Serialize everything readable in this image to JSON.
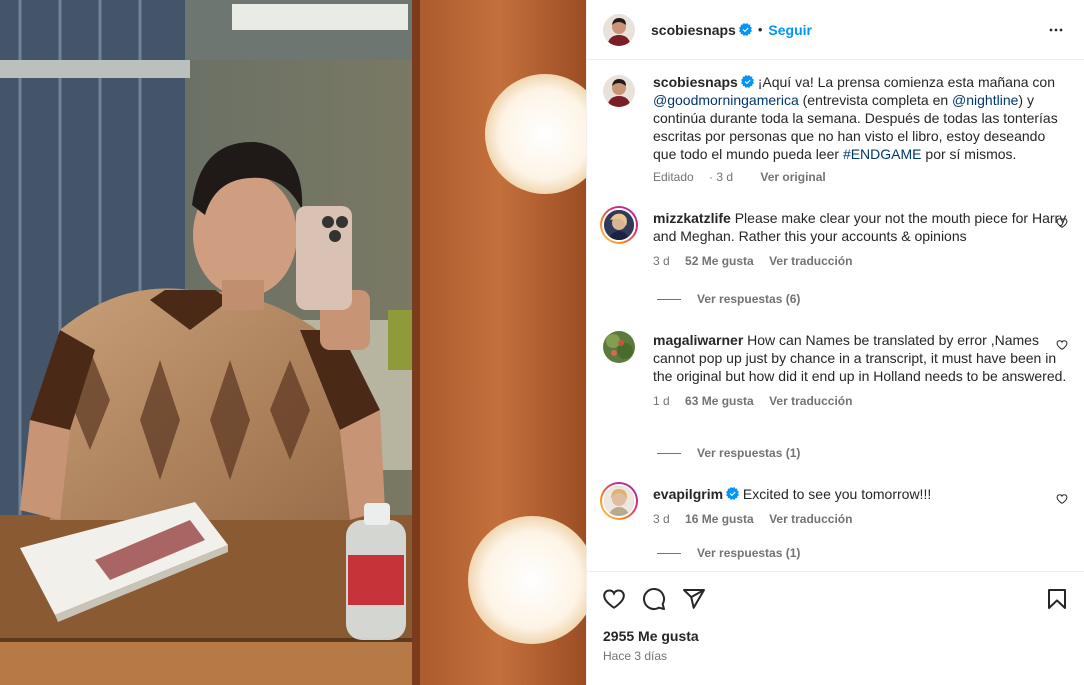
{
  "post": {
    "username": "scobiesnaps",
    "follow_label": "Seguir",
    "separator": "•",
    "caption": {
      "text_before": "¡Aquí va! La prensa comienza esta mañana con ",
      "mention1": "@goodmorningamerica",
      "text_mid": " (entrevista completa en ",
      "mention2": "@nightline",
      "text_after": ") y continúa durante toda la semana. Después de todas las tonterías escritas por personas que no han visto el libro, estoy deseando que todo el mundo pueda leer ",
      "hashtag": "#ENDGAME",
      "text_end": " por sí mismos.",
      "edited_label": "Editado",
      "time": "3 d",
      "see_original": "Ver original"
    },
    "likes_label": "2955 Me gusta",
    "posted_ago": "Hace 3 días"
  },
  "comments": [
    {
      "username": "mizzkatzlife",
      "text": "Please make clear your not the mouth piece for Harry and Meghan. Rather this your accounts & opinions",
      "time": "3 d",
      "likes": "52 Me gusta",
      "translate": "Ver traducción",
      "replies": "Ver respuestas (6)",
      "verified": false
    },
    {
      "username": "magaliwarner",
      "text": "How can Names be translated by error ,Names cannot pop up just by chance in a transcript, it must have been in the original but how did it end up in Holland needs to be answered.",
      "time": "1 d",
      "likes": "63 Me gusta",
      "translate": "Ver traducción",
      "replies": "Ver respuestas (1)",
      "verified": false
    },
    {
      "username": "evapilgrim",
      "text": "Excited to see you tomorrow!!!",
      "time": "3 d",
      "likes": "16 Me gusta",
      "translate": "Ver traducción",
      "replies": "Ver respuestas (1)",
      "verified": true
    }
  ],
  "colors": {
    "accent": "#0095f6",
    "verified": "#0095f6",
    "link": "#00376b",
    "muted": "#737373"
  },
  "icons": [
    "more-icon",
    "heart-icon",
    "comment-icon",
    "share-icon",
    "save-icon",
    "verified-icon"
  ]
}
